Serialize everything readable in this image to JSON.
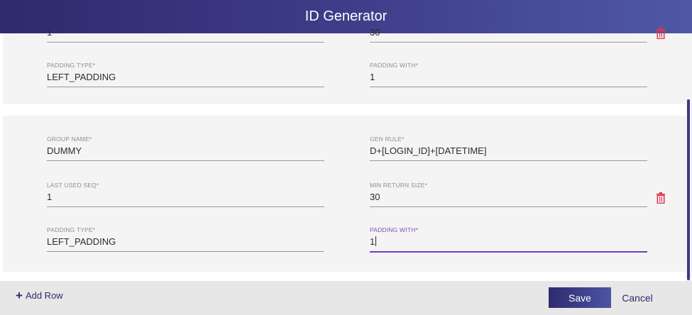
{
  "header": {
    "title": "ID Generator"
  },
  "rows": [
    {
      "fields": {
        "last_used_seq": {
          "label": "",
          "value": "1"
        },
        "min_return_size": {
          "label": "",
          "value": "30"
        },
        "padding_type": {
          "label": "PADDING TYPE*",
          "value": "LEFT_PADDING"
        },
        "padding_with": {
          "label": "PADDING WITH*",
          "value": "1"
        }
      }
    },
    {
      "fields": {
        "group_name": {
          "label": "GROUP NAME*",
          "value": "DUMMY"
        },
        "gen_rule": {
          "label": "GEN RULE*",
          "value": "D+[LOGIN_ID]+[DATETIME]"
        },
        "last_used_seq": {
          "label": "LAST USED SEQ*",
          "value": "1"
        },
        "min_return_size": {
          "label": "MIN RETURN SIZE*",
          "value": "30"
        },
        "padding_type": {
          "label": "PADDING TYPE*",
          "value": "LEFT_PADDING"
        },
        "padding_with": {
          "label": "PADDING WITH*",
          "value": "1"
        }
      }
    }
  ],
  "footer": {
    "add_row_label": "Add Row",
    "save_label": "Save",
    "cancel_label": "Cancel"
  },
  "icons": {
    "delete": "trash-icon",
    "add": "plus-icon"
  },
  "colors": {
    "primary": "#2f2a6e",
    "accent": "#6e3fc7",
    "delete": "#e0344d"
  }
}
